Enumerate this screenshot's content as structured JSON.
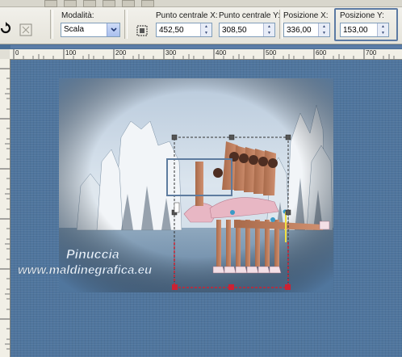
{
  "toolbar": {
    "mode_label": "Modalità:",
    "mode_value": "Scala",
    "center_x_label": "Punto centrale X:",
    "center_x_value": "452,50",
    "center_y_label": "Punto centrale Y:",
    "center_y_value": "308,50",
    "pos_x_label": "Posizione X:",
    "pos_x_value": "336,00",
    "pos_y_label": "Posizione Y:",
    "pos_y_value": "153,00"
  },
  "ruler": {
    "labels": [
      "0",
      "100",
      "200",
      "300",
      "400",
      "500",
      "600",
      "700"
    ]
  },
  "watermark": {
    "line1": "Pinuccia",
    "line2": "www.maldinegrafica.eu"
  },
  "colors": {
    "canvas": "#4f759d",
    "selection": "#333333",
    "handles_red": "#cc2233",
    "highlight": "#5c7aa3"
  }
}
